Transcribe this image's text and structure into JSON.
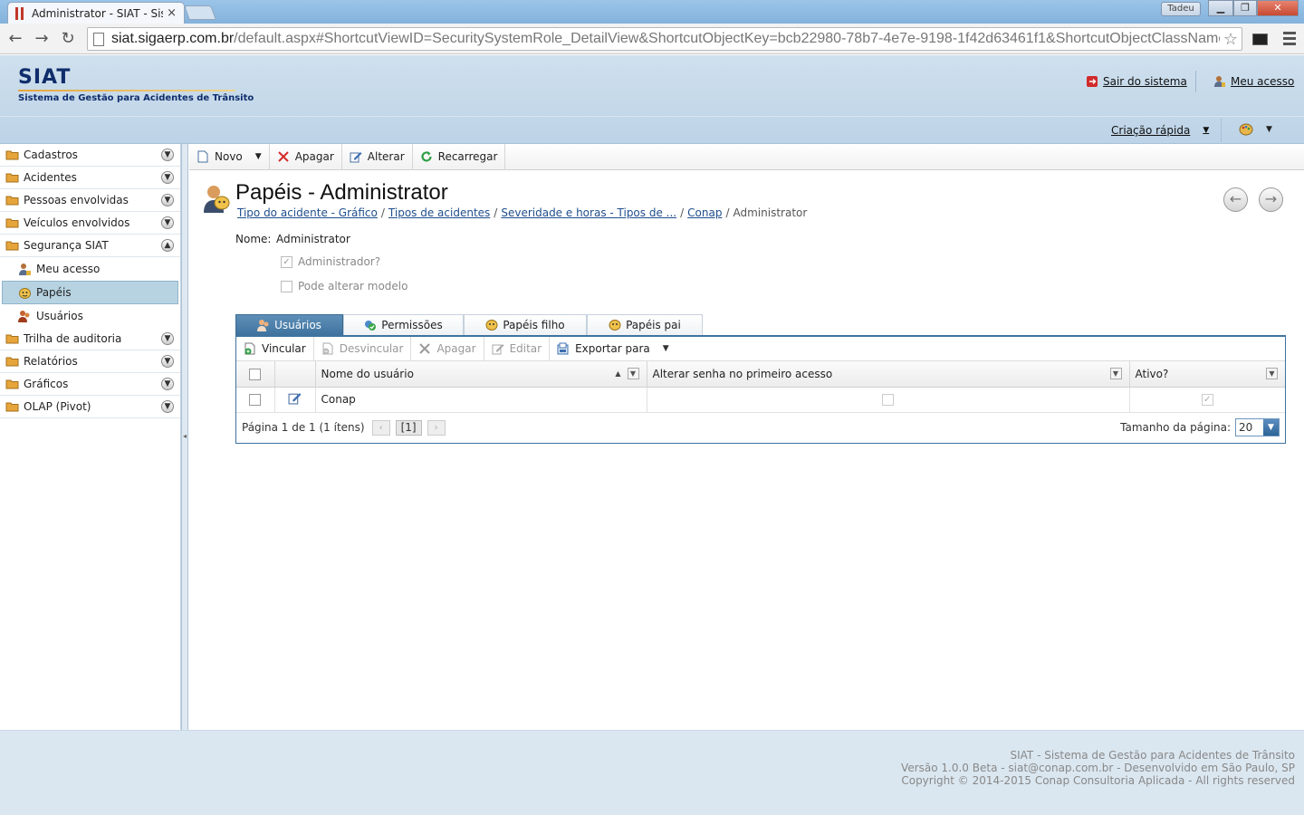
{
  "browser": {
    "tab_title": "Administrator - SIAT - Sist",
    "tab_close": "×",
    "user_label": "Tadeu",
    "url_host": "siat.sigaerp.com.br",
    "url_path": "/default.aspx#ShortcutViewID=SecuritySystemRole_DetailView&ShortcutObjectKey=bcb22980-78b7-4e7e-9198-1f42d63461f1&ShortcutObjectClassName=",
    "back": "←",
    "forward": "→",
    "reload": "↻",
    "star": "☆"
  },
  "header": {
    "brand": "SIAT",
    "subtitle": "Sistema de Gestão para Acidentes de Trânsito",
    "logout": "Sair do sistema",
    "my_access": "Meu acesso",
    "quick_create": "Criação rápida"
  },
  "sidebar": {
    "groups": [
      {
        "label": "Cadastros"
      },
      {
        "label": "Acidentes"
      },
      {
        "label": "Pessoas envolvidas"
      },
      {
        "label": "Veículos envolvidos"
      },
      {
        "label": "Segurança SIAT"
      },
      {
        "label": "Trilha de auditoria"
      },
      {
        "label": "Relatórios"
      },
      {
        "label": "Gráficos"
      },
      {
        "label": "OLAP (Pivot)"
      }
    ],
    "sub_items": [
      {
        "label": "Meu acesso"
      },
      {
        "label": "Papéis"
      },
      {
        "label": "Usuários"
      }
    ]
  },
  "toolbar": {
    "new": "Novo",
    "delete": "Apagar",
    "edit": "Alterar",
    "reload": "Recarregar"
  },
  "page": {
    "title": "Papéis - Administrator",
    "breadcrumb": [
      "Tipo do acidente - Gráfico",
      "Tipos de acidentes",
      "Severidade e horas - Tipos de ...",
      "Conap"
    ],
    "breadcrumb_current": "Administrator",
    "name_label": "Nome:",
    "name_value": "Administrator",
    "is_admin_label": "Administrador?",
    "can_edit_model_label": "Pode alterar modelo"
  },
  "tabs": [
    {
      "label": "Usuários"
    },
    {
      "label": "Permissões"
    },
    {
      "label": "Papéis filho"
    },
    {
      "label": "Papéis pai"
    }
  ],
  "grid": {
    "toolbar": {
      "link": "Vincular",
      "unlink": "Desvincular",
      "delete": "Apagar",
      "edit": "Editar",
      "export": "Exportar para"
    },
    "columns": [
      "Nome do usuário",
      "Alterar senha no primeiro acesso",
      "Ativo?"
    ],
    "rows": [
      {
        "name": "Conap",
        "change_pwd": false,
        "active": true
      }
    ],
    "pager": {
      "summary": "Página 1 de 1 (1 ítens)",
      "current": "[1]",
      "page_size_label": "Tamanho da página:",
      "page_size": "20"
    }
  },
  "footer": {
    "line1": "SIAT - Sistema de Gestão para Acidentes de Trânsito",
    "line2": "Versão 1.0.0 Beta - siat@conap.com.br - Desenvolvido em São Paulo, SP",
    "line3": "Copyright © 2014-2015 Conap Consultoria Aplicada - All rights reserved"
  },
  "colors": {
    "header_bg": "#c5d9ea",
    "active_tab": "#3f739f",
    "active_nav": "#b7d3e2",
    "link": "#1f4e8c"
  }
}
